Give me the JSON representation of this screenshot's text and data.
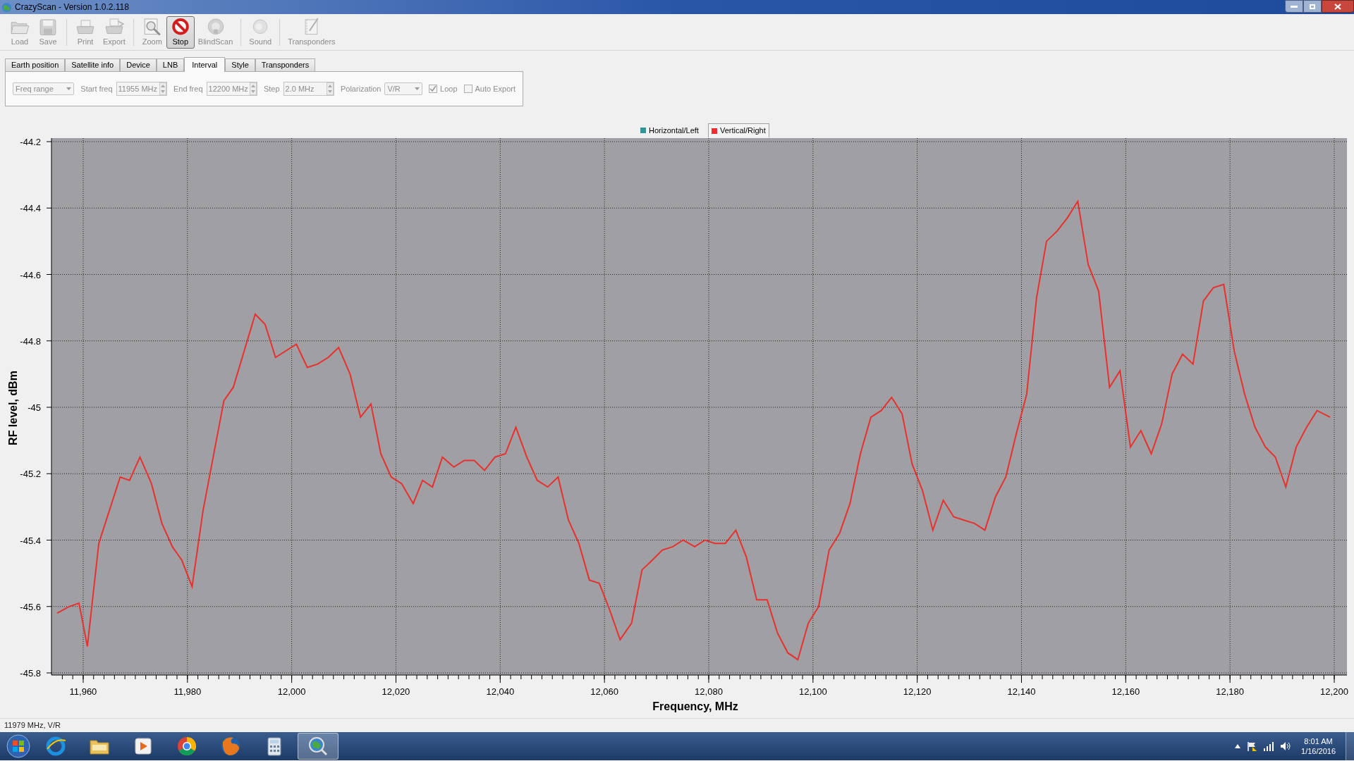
{
  "window": {
    "title": "CrazyScan - Version 1.0.2.118"
  },
  "toolbar": {
    "groups": [
      [
        {
          "label": "Load",
          "disabled": true,
          "pressed": false
        },
        {
          "label": "Save",
          "disabled": true,
          "pressed": false
        }
      ],
      [
        {
          "label": "Print",
          "disabled": true,
          "pressed": false
        },
        {
          "label": "Export",
          "disabled": true,
          "pressed": false
        }
      ],
      [
        {
          "label": "Zoom",
          "disabled": true,
          "pressed": false
        },
        {
          "label": "Stop",
          "disabled": false,
          "pressed": true
        },
        {
          "label": "BlindScan",
          "disabled": true,
          "pressed": false
        }
      ],
      [
        {
          "label": "Sound",
          "disabled": true,
          "pressed": false
        }
      ],
      [
        {
          "label": "Transponders",
          "disabled": true,
          "pressed": false
        }
      ]
    ]
  },
  "tabs": [
    {
      "label": "Earth position",
      "selected": false
    },
    {
      "label": "Satellite info",
      "selected": false
    },
    {
      "label": "Device",
      "selected": false
    },
    {
      "label": "LNB",
      "selected": false
    },
    {
      "label": "Interval",
      "selected": true
    },
    {
      "label": "Style",
      "selected": false
    },
    {
      "label": "Transponders",
      "selected": false
    }
  ],
  "interval_panel": {
    "disabled": true,
    "mode": "Freq range",
    "fields": [
      {
        "label": "Start freq",
        "value": "11955 MHz"
      },
      {
        "label": "End freq",
        "value": "12200 MHz"
      },
      {
        "label": "Step",
        "value": "2.0 MHz"
      }
    ],
    "polarization": {
      "label": "Polarization",
      "value": "V/R"
    },
    "checkboxes": [
      {
        "label": "Loop",
        "checked": true
      },
      {
        "label": "Auto Export",
        "checked": false
      }
    ]
  },
  "chart": {
    "legend": [
      {
        "selected": false
      },
      {
        "selected": true
      }
    ],
    "chart_data": {
      "type": "line",
      "grid": true,
      "xlabel": "Frequency, MHz",
      "ylabel": "RF level, dBm",
      "x": [
        11955,
        11957.3,
        11959.2,
        11960.8,
        11963,
        11967.1,
        11968.9,
        11970.9,
        11973.1,
        11975.1,
        11977.1,
        11978.9,
        11980.9,
        11983,
        11987,
        11988.8,
        11993,
        11994.9,
        11996.9,
        12000.9,
        12003,
        12005,
        12007,
        12009,
        12011.2,
        12013.2,
        12015.2,
        12017.1,
        12019.1,
        12021.1,
        12023.3,
        12025.1,
        12027,
        12028.9,
        12031.1,
        12033.1,
        12035,
        12037,
        12039,
        12041,
        12043,
        12045.1,
        12047.1,
        12049.1,
        12051.1,
        12053.1,
        12055.1,
        12057.1,
        12059,
        12061,
        12063,
        12065.2,
        12067.2,
        12069.2,
        12071.1,
        12073.1,
        12075.1,
        12077.3,
        12079.3,
        12081.2,
        12083.2,
        12085.2,
        12087.2,
        12089.2,
        12091.2,
        12093.2,
        12095.2,
        12097.1,
        12099.1,
        12101.1,
        12103.1,
        12105.1,
        12107.1,
        12109.1,
        12111.1,
        12113.1,
        12115.1,
        12117.1,
        12119,
        12121,
        12123,
        12125,
        12127,
        12129,
        12131,
        12133,
        12135,
        12137,
        12139,
        12141,
        12142.9,
        12144.8,
        12146.8,
        12148.8,
        12150.8,
        12152.8,
        12154.8,
        12156.9,
        12158.9,
        12160.9,
        12162.9,
        12164.9,
        12166.9,
        12168.9,
        12170.9,
        12172.9,
        12174.9,
        12176.8,
        12178.8,
        12180.8,
        12182.8,
        12184.8,
        12186.8,
        12188.7,
        12190.7,
        12192.7,
        12194.7,
        12196.7,
        12199.2
      ],
      "series": [
        {
          "name": "Horizontal/Left",
          "color": "#2e9496",
          "values": [
            null,
            null,
            null,
            null,
            null,
            null,
            null,
            null,
            null,
            null,
            null,
            null,
            null,
            null,
            null,
            null,
            null,
            null,
            null,
            null,
            null,
            null,
            null,
            null,
            null,
            null,
            null,
            null,
            null,
            null,
            null,
            null,
            null,
            null,
            null,
            null,
            null,
            null,
            null,
            null,
            null,
            null,
            null,
            null,
            null,
            null,
            null,
            null,
            null,
            null,
            null,
            null,
            null,
            null,
            null,
            null,
            null,
            null,
            null,
            null,
            null,
            null,
            null,
            null,
            null,
            null,
            null,
            null,
            null,
            null,
            null,
            null,
            null,
            null,
            null,
            null,
            null,
            null,
            null,
            null,
            null,
            null,
            null,
            null,
            null,
            null,
            null,
            null,
            null,
            null,
            null,
            null,
            null,
            null,
            null,
            null,
            null,
            null,
            null,
            null,
            null,
            null,
            null,
            null,
            null,
            null,
            null,
            null,
            null,
            null,
            null,
            null,
            null,
            null,
            null,
            null,
            null,
            null,
            null
          ]
        },
        {
          "name": "Vertical/Right",
          "color": "#e8302f",
          "values": [
            -45.62,
            -45.6,
            -45.59,
            -45.72,
            -45.41,
            -45.21,
            -45.22,
            -45.15,
            -45.23,
            -45.35,
            -45.42,
            -45.46,
            -45.54,
            -45.31,
            -44.98,
            -44.94,
            -44.72,
            -44.75,
            -44.85,
            -44.81,
            -44.88,
            -44.87,
            -44.85,
            -44.82,
            -44.9,
            -45.03,
            -44.99,
            -45.14,
            -45.21,
            -45.23,
            -45.29,
            -45.22,
            -45.24,
            -45.15,
            -45.18,
            -45.16,
            -45.16,
            -45.19,
            -45.15,
            -45.14,
            -45.06,
            -45.15,
            -45.22,
            -45.24,
            -45.21,
            -45.34,
            -45.41,
            -45.52,
            -45.53,
            -45.61,
            -45.7,
            -45.65,
            -45.49,
            -45.46,
            -45.43,
            -45.42,
            -45.4,
            -45.42,
            -45.4,
            -45.41,
            -45.41,
            -45.37,
            -45.45,
            -45.58,
            -45.58,
            -45.68,
            -45.74,
            -45.76,
            -45.65,
            -45.6,
            -45.43,
            -45.38,
            -45.29,
            -45.14,
            -45.03,
            -45.01,
            -44.97,
            -45.02,
            -45.17,
            -45.25,
            -45.37,
            -45.28,
            -45.33,
            -45.34,
            -45.35,
            -45.37,
            -45.27,
            -45.21,
            -45.08,
            -44.96,
            -44.67,
            -44.5,
            -44.47,
            -44.43,
            -44.38,
            -44.57,
            -44.65,
            -44.94,
            -44.89,
            -45.12,
            -45.07,
            -45.14,
            -45.05,
            -44.9,
            -44.84,
            -44.87,
            -44.68,
            -44.64,
            -44.63,
            -44.83,
            -44.96,
            -45.06,
            -45.12,
            -45.15,
            -45.24,
            -45.12,
            -45.06,
            -45.01,
            -45.03
          ]
        }
      ],
      "xlim": [
        11955,
        12200
      ],
      "ylim": [
        -45.8,
        -44.2
      ],
      "xticks": [
        {
          "value": 11960,
          "label": "11,960"
        },
        {
          "value": 11980,
          "label": "11,980"
        },
        {
          "value": 12000,
          "label": "12,000"
        },
        {
          "value": 12020,
          "label": "12,020"
        },
        {
          "value": 12040,
          "label": "12,040"
        },
        {
          "value": 12060,
          "label": "12,060"
        },
        {
          "value": 12080,
          "label": "12,080"
        },
        {
          "value": 12100,
          "label": "12,100"
        },
        {
          "value": 12120,
          "label": "12,120"
        },
        {
          "value": 12140,
          "label": "12,140"
        },
        {
          "value": 12160,
          "label": "12,160"
        },
        {
          "value": 12180,
          "label": "12,180"
        },
        {
          "value": 12200,
          "label": "12,200"
        }
      ],
      "yticks": [
        -44.2,
        -44.4,
        -44.6,
        -44.8,
        {
          "value": -45,
          "label": "-45"
        },
        -45.2,
        -45.4,
        -45.6,
        -45.8
      ]
    }
  },
  "status_bar": "11979 MHz, V/R",
  "taskbar": {
    "apps": [
      {
        "selected": false
      },
      {
        "selected": false
      },
      {
        "selected": false
      },
      {
        "selected": false
      },
      {
        "selected": false
      },
      {
        "selected": false
      },
      {
        "selected": true
      }
    ],
    "time": "8:01 AM",
    "date": "1/16/2016"
  }
}
